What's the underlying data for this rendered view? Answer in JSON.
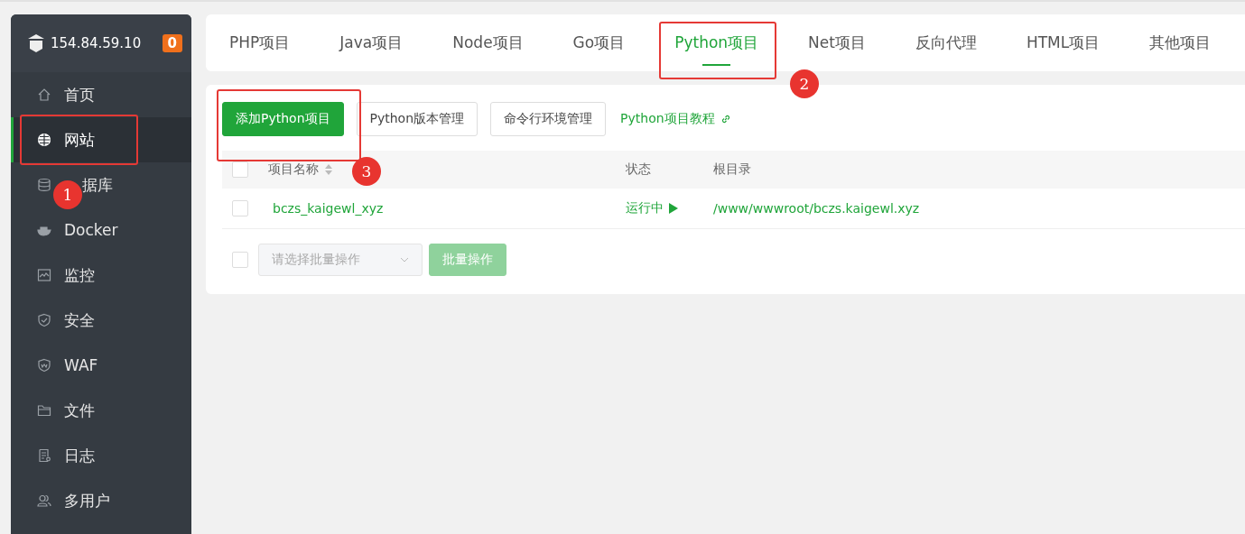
{
  "sidebar": {
    "server": "154.84.59.10",
    "alert_count": "0",
    "items": [
      {
        "label": "首页",
        "selected": false
      },
      {
        "label": "网站",
        "selected": true
      },
      {
        "label": "据库",
        "selected": false
      },
      {
        "label": "Docker",
        "selected": false
      },
      {
        "label": "监控",
        "selected": false
      },
      {
        "label": "安全",
        "selected": false
      },
      {
        "label": "WAF",
        "selected": false
      },
      {
        "label": "文件",
        "selected": false
      },
      {
        "label": "日志",
        "selected": false
      },
      {
        "label": "多用户",
        "selected": false
      }
    ]
  },
  "tabs": [
    {
      "label": "PHP项目",
      "selected": false
    },
    {
      "label": "Java项目",
      "selected": false
    },
    {
      "label": "Node项目",
      "selected": false
    },
    {
      "label": "Go项目",
      "selected": false
    },
    {
      "label": "Python项目",
      "selected": true
    },
    {
      "label": "Net项目",
      "selected": false
    },
    {
      "label": "反向代理",
      "selected": false
    },
    {
      "label": "HTML项目",
      "selected": false
    },
    {
      "label": "其他项目",
      "selected": false
    }
  ],
  "toolbar": {
    "primary": "添加Python项目",
    "buttons": [
      "Python版本管理",
      "命令行环境管理"
    ],
    "link": "Python项目教程"
  },
  "table": {
    "all_checked": false,
    "columns": [
      "项目名称",
      "状态",
      "根目录"
    ],
    "rows": [
      {
        "name": "bczs_kaigewl_xyz",
        "status": "运行中",
        "root": "/www/wwwroot/bczs.kaigewl.xyz",
        "checked": false
      }
    ]
  },
  "batch": {
    "checked": false,
    "placeholder": "请选择批量操作",
    "button": "批量操作"
  },
  "annotations": [
    {
      "label": "1"
    },
    {
      "label": "2"
    },
    {
      "label": "3"
    }
  ]
}
